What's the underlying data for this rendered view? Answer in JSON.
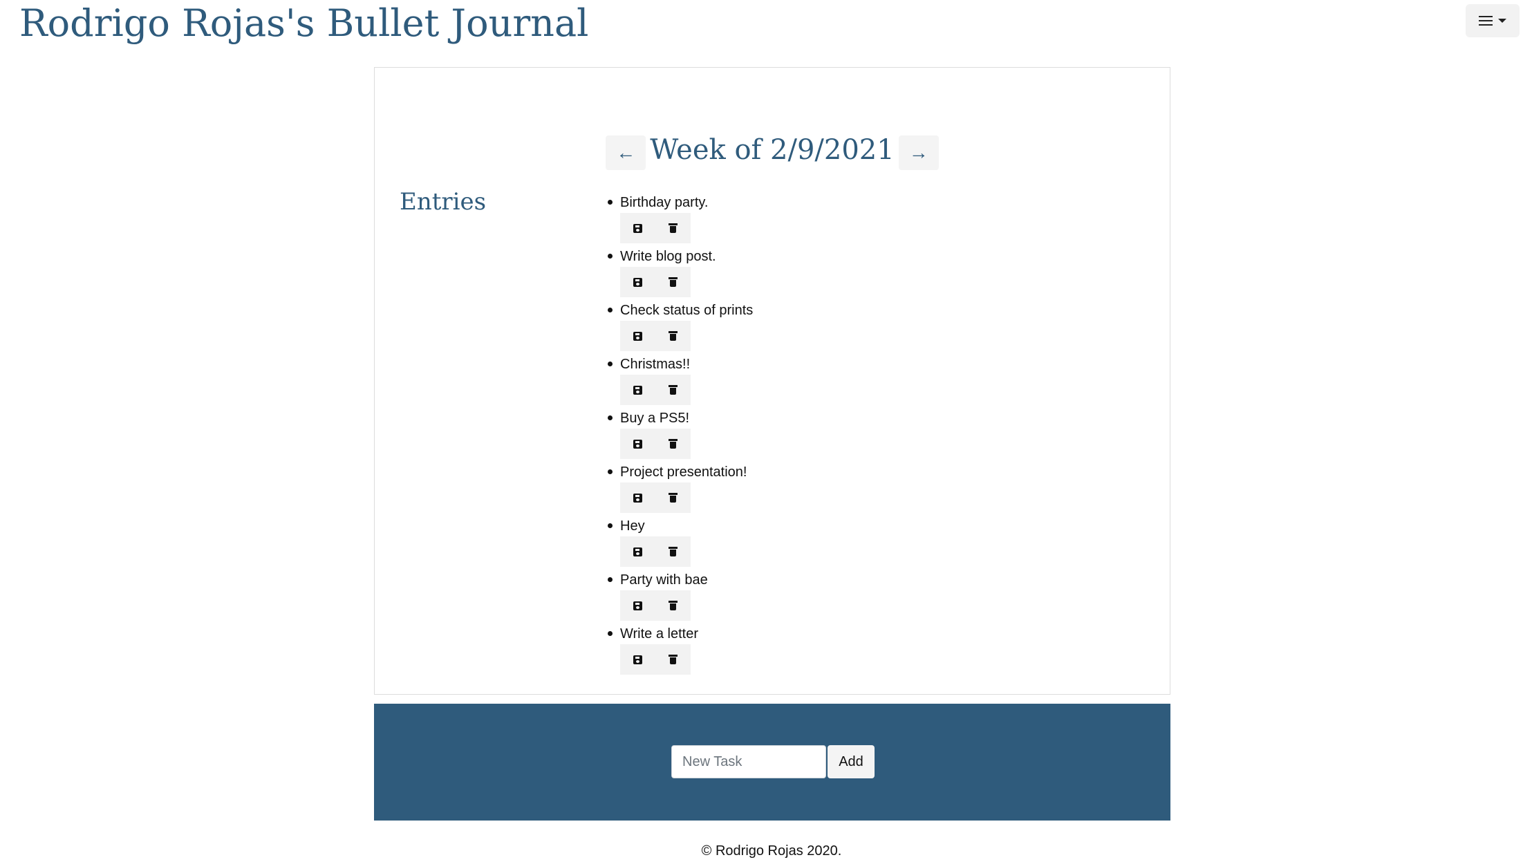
{
  "header": {
    "title": "Rodrigo Rojas's Bullet Journal",
    "menu_icon": "hamburger-menu-icon"
  },
  "week": {
    "title": "Week of 2/9/2021",
    "prev_icon": "arrow-left-icon",
    "prev_glyph": "←",
    "next_icon": "arrow-right-icon",
    "next_glyph": "→"
  },
  "entries": {
    "heading": "Entries",
    "items": [
      {
        "text": "Birthday party."
      },
      {
        "text": "Write blog post."
      },
      {
        "text": "Check status of prints"
      },
      {
        "text": "Christmas!!"
      },
      {
        "text": "Buy a PS5!"
      },
      {
        "text": "Project presentation!"
      },
      {
        "text": "Hey"
      },
      {
        "text": "Party with bae"
      },
      {
        "text": "Write a letter"
      }
    ],
    "save_icon": "save-icon",
    "delete_icon": "trash-icon"
  },
  "new_task": {
    "placeholder": "New Task",
    "value": "",
    "add_label": "Add"
  },
  "footer": {
    "copyright": "© Rodrigo Rojas 2020."
  },
  "colors": {
    "accent": "#2f5b7c",
    "button_bg": "#f2f2f2",
    "card_border": "#dcdcdc"
  }
}
